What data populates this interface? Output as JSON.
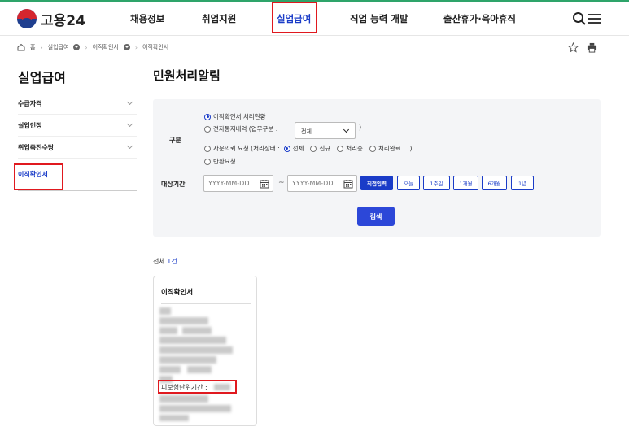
{
  "header": {
    "logo_text": "고용24",
    "nav": [
      "채용정보",
      "취업지원",
      "실업급여",
      "직업 능력 개발",
      "출산휴가·육아휴직"
    ],
    "active_nav_index": 2
  },
  "breadcrumb": [
    "홈",
    "실업급여",
    "이직확인서",
    "이직확인서"
  ],
  "sidebar": {
    "title": "실업급여",
    "items": [
      {
        "label": "수급자격"
      },
      {
        "label": "실업인정"
      },
      {
        "label": "취업촉진수당"
      },
      {
        "label": "이직확인서"
      }
    ],
    "active_index": 3
  },
  "main": {
    "title": "민원처리알림",
    "search": {
      "category_label": "구분",
      "radio1": "이직확인서 처리현황",
      "radio2_prefix": "전자통지내역 (업무구분 :",
      "select_value": "전체",
      "radio2_suffix": ")",
      "radio3_prefix": "자문의뢰 요청 (처리상태 :",
      "status_options": [
        "전체",
        "신규",
        "처리중",
        "처리완료"
      ],
      "radio3_suffix": ")",
      "radio4": "반환요청",
      "period_label": "대상기간",
      "date_placeholder": "YYYY-MM-DD",
      "date_sep": "~",
      "period_buttons": [
        "직접입력",
        "오늘",
        "1주일",
        "1개월",
        "6개월",
        "1년"
      ],
      "search_button": "검색"
    },
    "total_prefix": "전체",
    "total_count": "1건",
    "card": {
      "title": "이직확인서",
      "field_label": "피보험단위기간 :"
    }
  },
  "colors": {
    "brand_blue": "#1a3cc8",
    "highlight_red": "#e0191f"
  }
}
